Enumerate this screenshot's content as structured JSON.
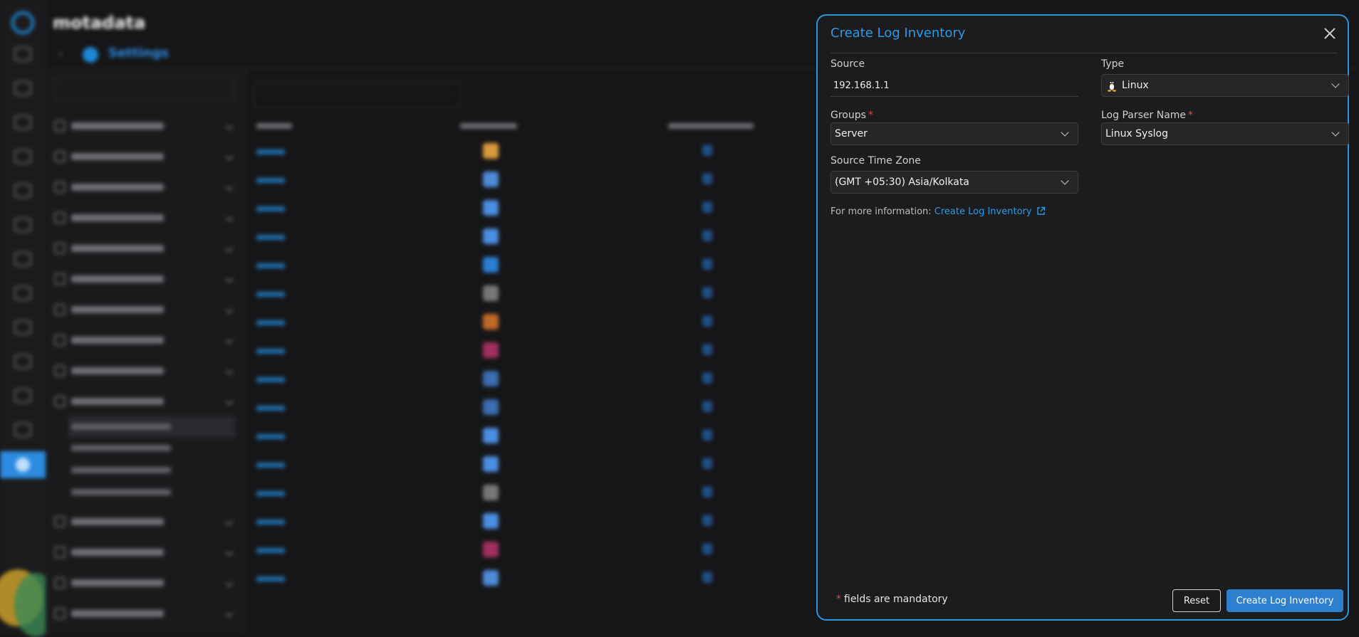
{
  "app": {
    "brand": "motadata"
  },
  "breadcrumb": {
    "title": "Settings"
  },
  "modal": {
    "title": "Create Log Inventory",
    "fields": {
      "source": {
        "label": "Source",
        "value": "192.168.1.1"
      },
      "type": {
        "label": "Type",
        "value": "Linux",
        "icon": "linux-tux-icon"
      },
      "groups": {
        "label": "Groups",
        "value": "Server",
        "required": true
      },
      "log_parser_name": {
        "label": "Log Parser Name",
        "value": "Linux Syslog",
        "required": true
      },
      "source_time_zone": {
        "label": "Source Time Zone",
        "value": "(GMT +05:30) Asia/Kolkata"
      }
    },
    "info": {
      "prefix": "For more information: ",
      "link_text": "Create Log Inventory"
    },
    "footer": {
      "mandatory_star": "*",
      "mandatory_note": "fields are mandatory",
      "reset_label": "Reset",
      "submit_label": "Create Log Inventory"
    },
    "required_mark": "*"
  },
  "colors": {
    "accent": "#2c9be6",
    "primary_button": "#2d7fd0",
    "required": "#e04848",
    "panel_border": "#2a96dc"
  }
}
